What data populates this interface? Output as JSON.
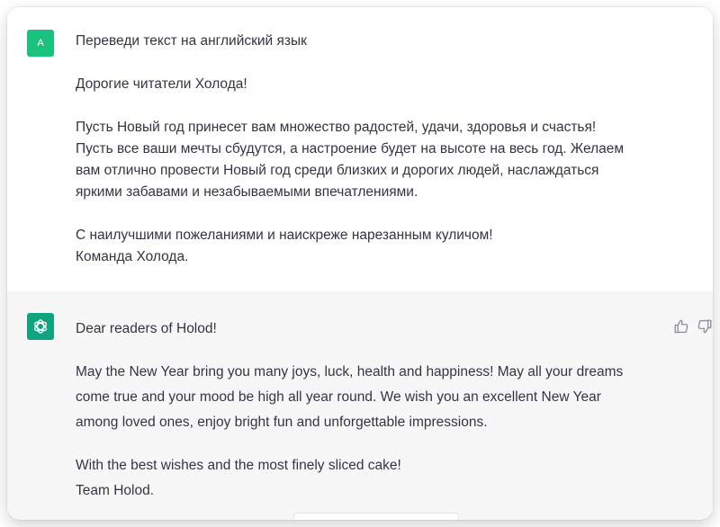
{
  "user_message": {
    "avatar_letter": "A",
    "paragraphs": [
      [
        "Переведи текст на английский язык"
      ],
      [
        "Дорогие читатели Холода!"
      ],
      [
        "Пусть Новый год принесет вам множество радостей, удачи, здоровья и счастья!",
        "Пусть все ваши мечты сбудутся, а настроение будет на высоте на весь год. Желаем",
        "вам отлично провести Новый год среди близких и дорогих людей, наслаждаться",
        "яркими забавами и незабываемыми впечатлениями."
      ],
      [
        "С наилучшими пожеланиями и наискреже нарезанным куличом!",
        "Команда Холода."
      ]
    ]
  },
  "assistant_message": {
    "avatar_icon": "openai-logo-icon",
    "paragraphs": [
      [
        "Dear readers of Holod!"
      ],
      [
        "May the New Year bring you many joys, luck, health and happiness! May all your dreams",
        "come true and your mood be high all year round. We wish you an excellent New Year",
        "among loved ones, enjoy bright fun and unforgettable impressions."
      ],
      [
        "With the best wishes and the most finely sliced cake!",
        "Team Holod."
      ]
    ],
    "feedback_icons": [
      "thumbs-up-icon",
      "thumbs-down-icon"
    ]
  },
  "colors": {
    "user_avatar": "#19c37d",
    "assistant_avatar": "#10a37f",
    "assistant_bg": "#f7f7f8",
    "text": "#343541"
  }
}
